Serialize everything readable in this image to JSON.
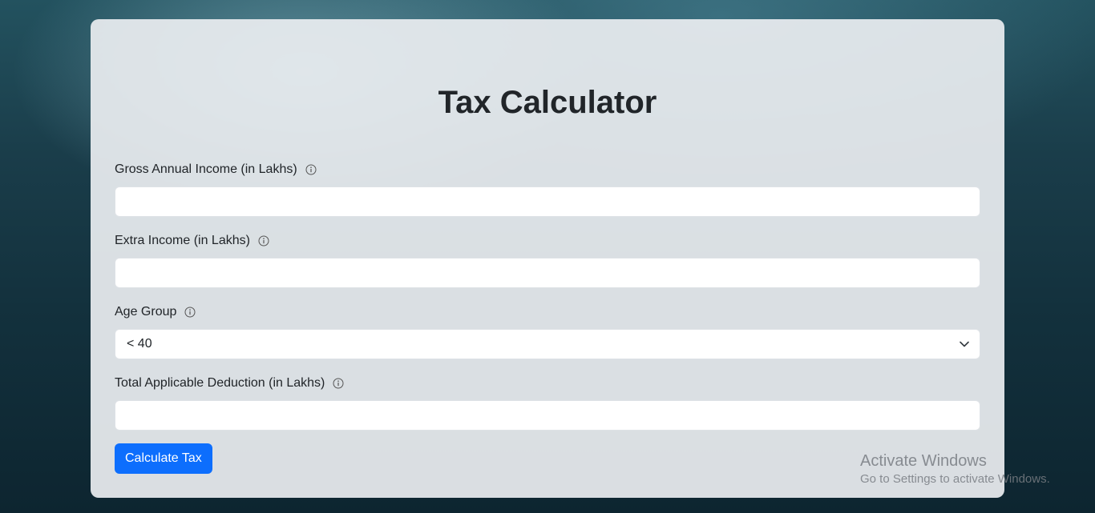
{
  "page": {
    "title": "Tax Calculator"
  },
  "form": {
    "gross_income": {
      "label": "Gross Annual Income (in Lakhs)",
      "value": "",
      "placeholder": ""
    },
    "extra_income": {
      "label": "Extra Income (in Lakhs)",
      "value": "",
      "placeholder": ""
    },
    "age_group": {
      "label": "Age Group",
      "selected": "< 40"
    },
    "deductions": {
      "label": "Total Applicable Deduction (in Lakhs)",
      "value": "",
      "placeholder": ""
    },
    "submit_label": "Calculate Tax"
  },
  "icons": {
    "info": "info-icon",
    "dropdown": "chevron-down-icon"
  },
  "colors": {
    "primary": "#0d6efd",
    "card_background": "#eaedf0",
    "text": "#212529"
  },
  "watermark": {
    "title": "Activate Windows",
    "subtitle": "Go to Settings to activate Windows."
  }
}
